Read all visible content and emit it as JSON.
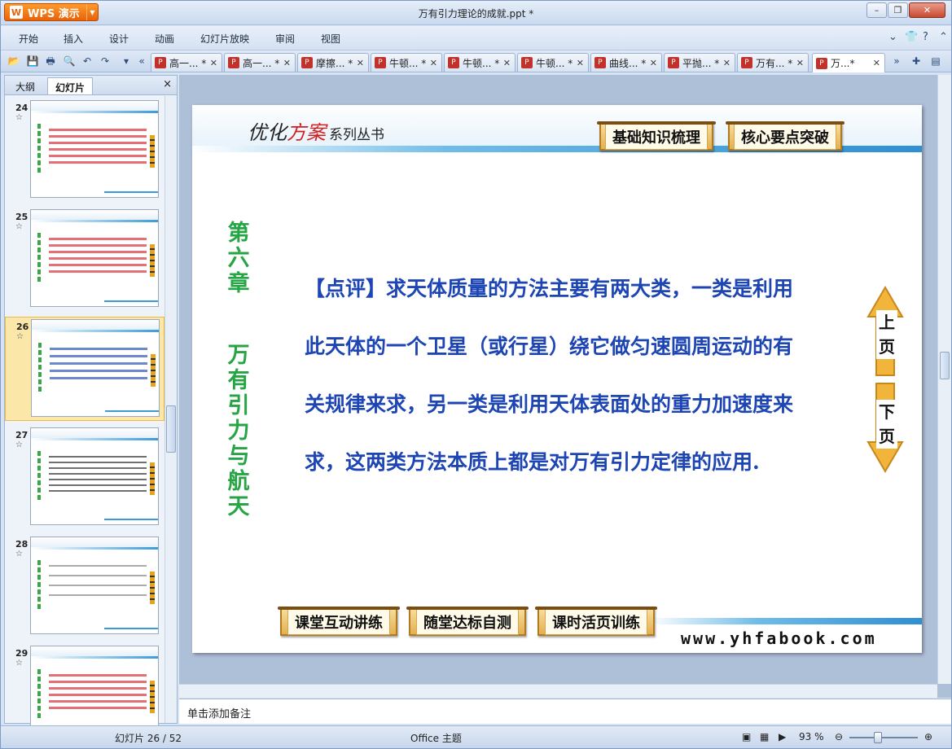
{
  "window": {
    "app_name": "WPS 演示",
    "app_logo": "W",
    "title": "万有引力理论的成就.ppt *"
  },
  "menu": [
    "开始",
    "插入",
    "设计",
    "动画",
    "幻灯片放映",
    "审阅",
    "视图"
  ],
  "doc_tabs": [
    {
      "label": "高一... *"
    },
    {
      "label": "高一... *"
    },
    {
      "label": "摩擦... *"
    },
    {
      "label": "牛顿... *"
    },
    {
      "label": "牛顿... *"
    },
    {
      "label": "牛顿... *"
    },
    {
      "label": "曲线... *"
    },
    {
      "label": "平抛... *"
    },
    {
      "label": "万有... *"
    },
    {
      "label": "万...*"
    }
  ],
  "left_pane": {
    "tab_outline": "大纲",
    "tab_slides": "幻灯片",
    "close": "×",
    "thumbnails": [
      {
        "num": "24",
        "star": "☆"
      },
      {
        "num": "25",
        "star": "☆"
      },
      {
        "num": "26",
        "star": "☆"
      },
      {
        "num": "27",
        "star": "☆"
      },
      {
        "num": "28",
        "star": "☆"
      },
      {
        "num": "29",
        "star": "☆"
      }
    ]
  },
  "slide": {
    "brand_a": "优化",
    "brand_b": "方案",
    "brand_sub": "系列丛书",
    "top_buttons": [
      "基础知识梳理",
      "核心要点突破"
    ],
    "chapter": [
      "第",
      "六",
      "章"
    ],
    "chapter_title": [
      "万",
      "有",
      "引",
      "力",
      "与",
      "航",
      "天"
    ],
    "content": "【点评】求天体质量的方法主要有两大类，一类是利用此天体的一个卫星（或行星）绕它做匀速圆周运动的有关规律来求，另一类是利用天体表面处的重力加速度来求，这两类方法本质上都是对万有引力定律的应用.",
    "nav_up": [
      "上",
      "页"
    ],
    "nav_down": [
      "下",
      "页"
    ],
    "bottom_buttons": [
      "课堂互动讲练",
      "随堂达标自测",
      "课时活页训练"
    ],
    "website": "www.yhfabook.com"
  },
  "notes_placeholder": "单击添加备注",
  "status": {
    "slide_info": "幻灯片 26 / 52",
    "theme": "Office 主题",
    "zoom": "93 %"
  }
}
